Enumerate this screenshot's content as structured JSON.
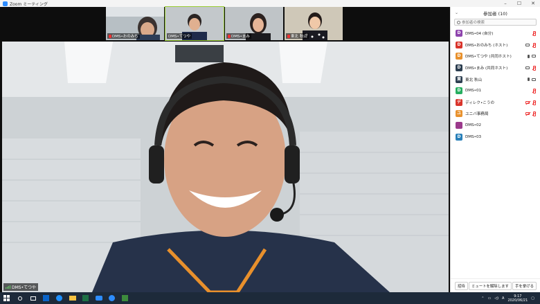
{
  "window": {
    "title": "Zoom ミーティング"
  },
  "thumbnails": [
    {
      "name": "DMS•おのみち",
      "muted": true
    },
    {
      "name": "DMS•てつや",
      "muted": false,
      "active": true
    },
    {
      "name": "DMS•まみ",
      "muted": true
    },
    {
      "name": "東北 秋山",
      "muted": true
    }
  ],
  "main_video": {
    "name": "DMS•てつや"
  },
  "participants_panel": {
    "title": "参加者 (10)",
    "search_placeholder": "参加者の検索",
    "participants": [
      {
        "initial": "D",
        "color": "#8e44ad",
        "name": "DMS•04 (自分)",
        "mic": "muted",
        "cam": "none"
      },
      {
        "initial": "D",
        "color": "#d9342b",
        "name": "DMS•おのみち (ホスト)",
        "mic": "muted",
        "cam": "on"
      },
      {
        "initial": "D",
        "color": "#e8912d",
        "name": "DMS•てつや (共同ホスト)",
        "mic": "on",
        "cam": "on"
      },
      {
        "initial": "D",
        "color": "#2c3e50",
        "name": "DMS•まみ (共同ホスト)",
        "mic": "muted",
        "cam": "on"
      },
      {
        "initial": "東",
        "color": "#2c3e50",
        "name": "東北 秋山",
        "mic": "on",
        "cam": "on"
      },
      {
        "initial": "D",
        "color": "#27ae60",
        "name": "DMS•01",
        "mic": "muted",
        "cam": "none"
      },
      {
        "initial": "デ",
        "color": "#d9342b",
        "name": "ディレク•こうの",
        "mic": "muted",
        "cam": "off"
      },
      {
        "initial": "ユ",
        "color": "#e8912d",
        "name": "ユニバ事務局",
        "mic": "muted",
        "cam": "off"
      },
      {
        "initial": "",
        "color": "#9b3a8c",
        "name": "DMS•02",
        "mic": "none",
        "cam": "none"
      },
      {
        "initial": "D",
        "color": "#2980b9",
        "name": "DMS•03",
        "mic": "none",
        "cam": "none"
      }
    ],
    "footer": {
      "invite": "招待",
      "unmute": "ミュートを解除します",
      "raise_hand": "手を挙げる"
    }
  },
  "taskbar": {
    "time": "9:17",
    "date": "2020/06/21",
    "ime": "A"
  }
}
